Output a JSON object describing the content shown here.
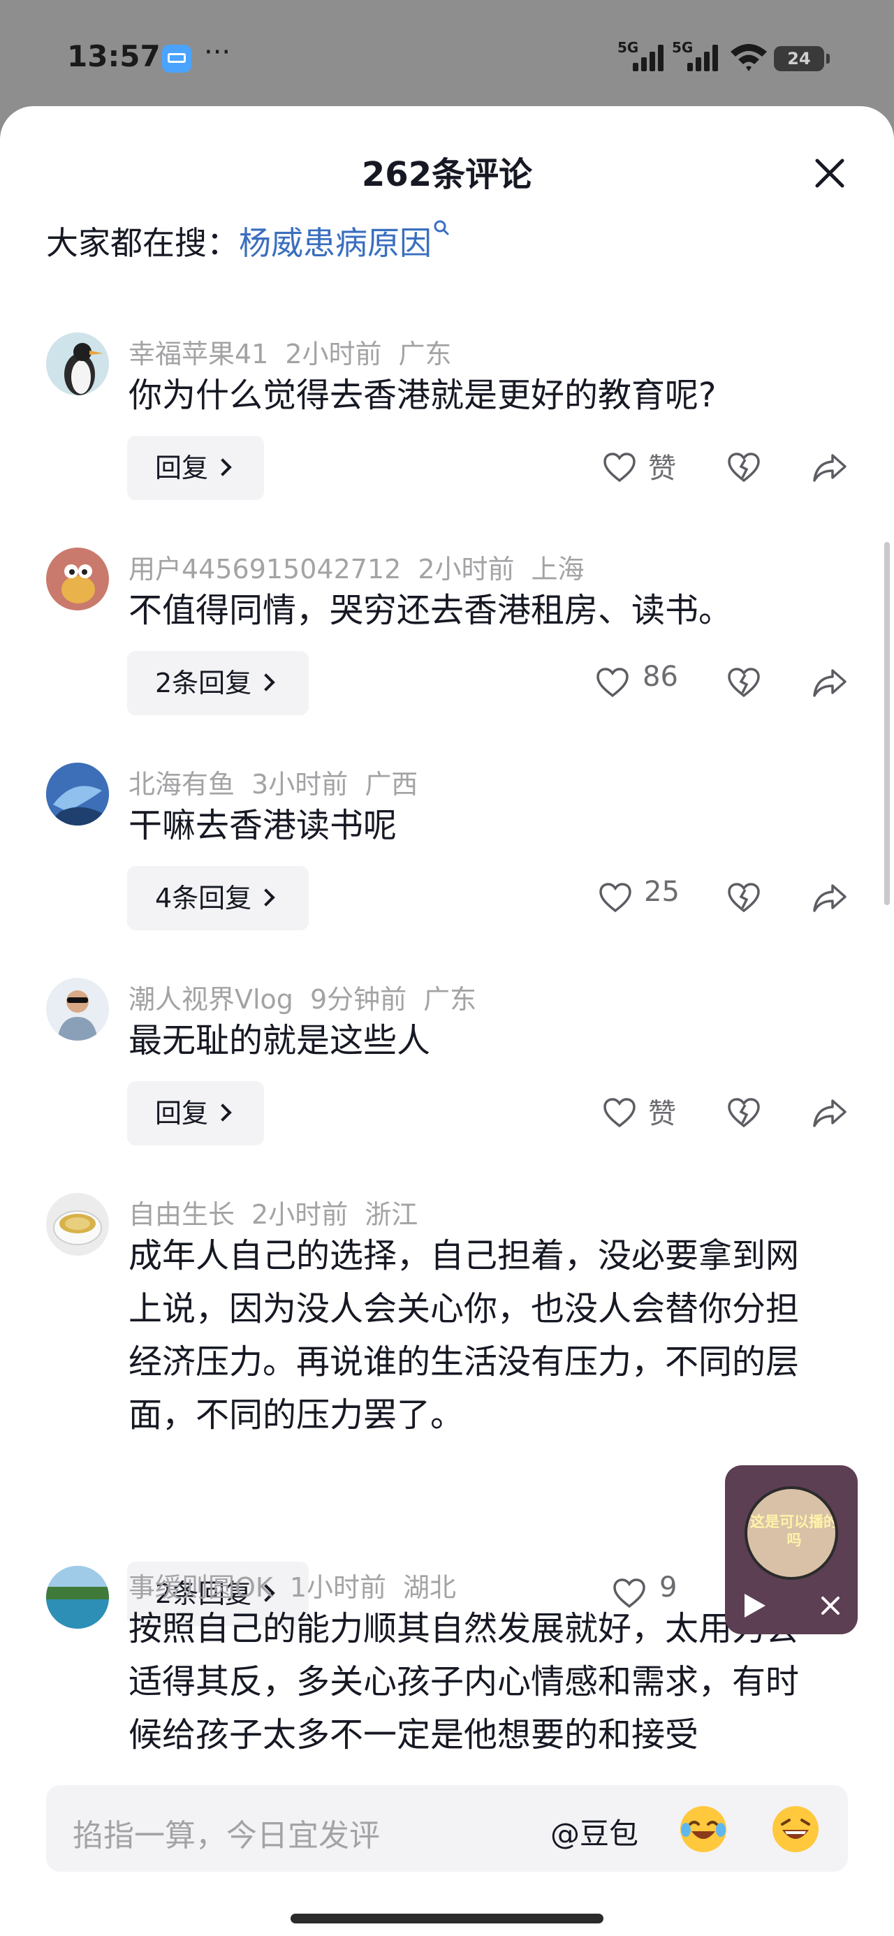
{
  "status_bar": {
    "time": "13:57",
    "more": "···",
    "sim1": "5G",
    "sim2": "5G",
    "battery": "24"
  },
  "sheet": {
    "title": "262条评论",
    "search_prefix": "大家都在搜：",
    "search_keyword": "杨威患病原因"
  },
  "comments": [
    {
      "user": "幸福苹果41",
      "time": "2小时前",
      "region": "广东",
      "text": "你为什么觉得去香港就是更好的教育呢?",
      "reply": "回复",
      "likes": "赞"
    },
    {
      "user": "用户4456915042712",
      "time": "2小时前",
      "region": "上海",
      "text": "不值得同情，哭穷还去香港租房、读书。",
      "reply": "2条回复",
      "likes": "86"
    },
    {
      "user": "北海有鱼",
      "time": "3小时前",
      "region": "广西",
      "text": "干嘛去香港读书呢",
      "reply": "4条回复",
      "likes": "25"
    },
    {
      "user": "潮人视界Vlog",
      "time": "9分钟前",
      "region": "广东",
      "text": "最无耻的就是这些人",
      "reply": "回复",
      "likes": "赞"
    },
    {
      "user": "自由生长",
      "time": "2小时前",
      "region": "浙江",
      "text": "成年人自己的选择，自己担着，没必要拿到网上说，因为没人会关心你，也没人会替你分担经济压力。再说谁的生活没有压力，不同的层面，不同的压力罢了。",
      "reply": "2条回复",
      "likes": "9"
    },
    {
      "user": "事缓则圆OK",
      "time": "1小时前",
      "region": "湖北",
      "text": "按照自己的能力顺其自然发展就好，太用力会适得其反，多关心孩子内心情感和需求，有时候给孩子太多不一定是他想要的和接受"
    }
  ],
  "mini_player": {
    "caption": "这是可以播的吗"
  },
  "input": {
    "placeholder": "掐指一算，今日宜发评",
    "mention": "@豆包"
  },
  "colors": {
    "keyword": "#3a6fbf",
    "meta": "#a3a3a6",
    "text": "#161823",
    "button_bg": "#f3f3f5"
  }
}
